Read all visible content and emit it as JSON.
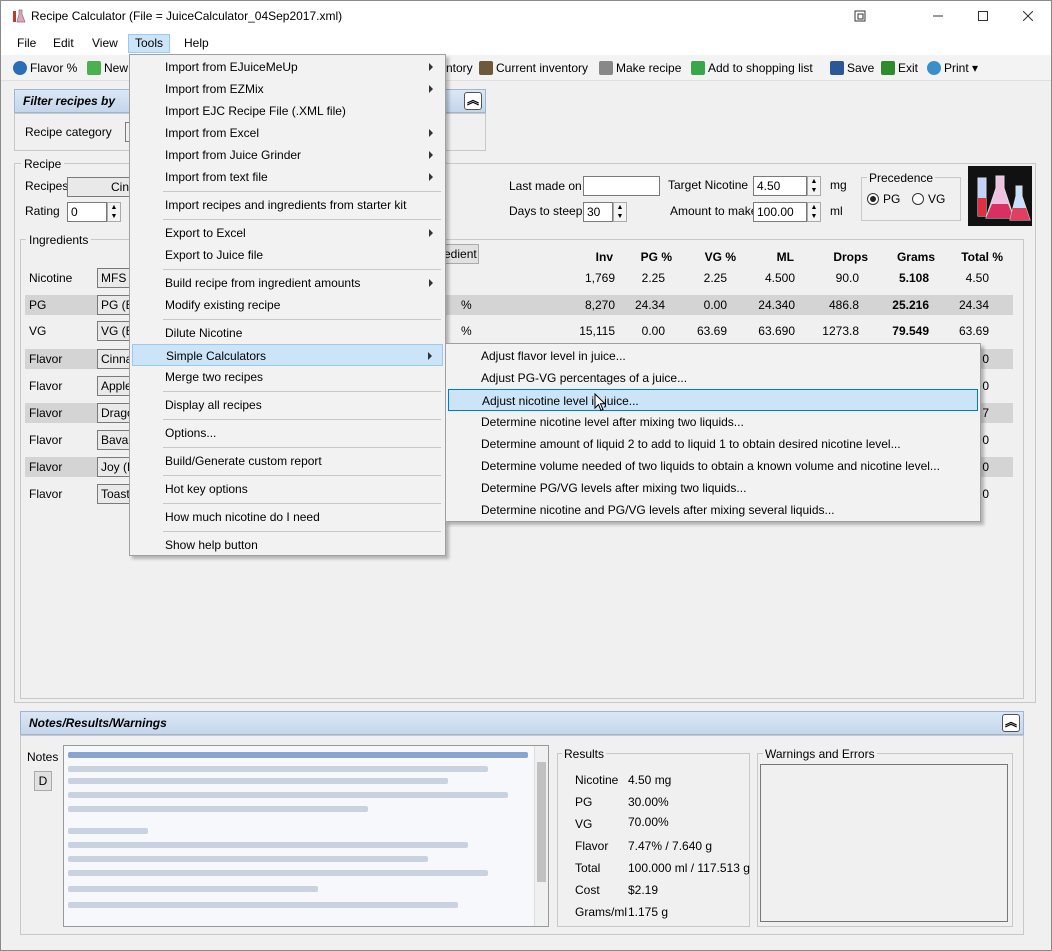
{
  "window": {
    "title": "Recipe Calculator (File = JuiceCalculator_04Sep2017.xml)"
  },
  "menubar": {
    "file": "File",
    "edit": "Edit",
    "view": "View",
    "tools": "Tools",
    "help": "Help"
  },
  "toolbar": {
    "flavor": "Flavor %",
    "new": "New",
    "inventory_partial": "ntory",
    "current_inventory": "Current inventory",
    "make_recipe": "Make recipe",
    "add_shopping": "Add to shopping list",
    "save": "Save",
    "exit": "Exit",
    "print": "Print"
  },
  "filter": {
    "title": "Filter recipes by",
    "category_label": "Recipe category"
  },
  "recipe": {
    "group_label": "Recipe",
    "recipes_label": "Recipes",
    "recipes_value": "Cin",
    "rating_label": "Rating",
    "rating_value": "0",
    "last_made_label": "Last made on",
    "last_made_value": "",
    "days_steep_label": "Days to steep",
    "days_steep_value": "30",
    "target_nic_label": "Target Nicotine",
    "target_nic_value": "4.50",
    "target_nic_unit": "mg",
    "amount_label": "Amount to make",
    "amount_value": "100.00",
    "amount_unit": "ml",
    "precedence_label": "Precedence",
    "pg_label": "PG",
    "vg_label": "VG"
  },
  "ingredients": {
    "group_label": "Ingredients",
    "add_btn_partial": "edient",
    "pct": "%",
    "headers": {
      "inv": "Inv",
      "pg": "PG %",
      "vg": "VG %",
      "ml": "ML",
      "drops": "Drops",
      "grams": "Grams",
      "total": "Total %"
    },
    "rows": [
      {
        "type": "Nicotine",
        "name": "MFS N",
        "inv": "1,769",
        "pg": "2.25",
        "vg": "2.25",
        "ml": "4.500",
        "drops": "90.0",
        "grams": "5.108",
        "total": "4.50"
      },
      {
        "type": "PG",
        "name": "PG (E",
        "inv": "8,270",
        "pg": "24.34",
        "vg": "0.00",
        "ml": "24.340",
        "drops": "486.8",
        "grams": "25.216",
        "total": "24.34"
      },
      {
        "type": "VG",
        "name": "VG (E",
        "inv": "15,115",
        "pg": "0.00",
        "vg": "63.69",
        "ml": "63.690",
        "drops": "1273.8",
        "grams": "79.549",
        "total": "63.69"
      },
      {
        "type": "Flavor",
        "name": "Cinnar",
        "total": "0"
      },
      {
        "type": "Flavor",
        "name": "Apple",
        "total": "0"
      },
      {
        "type": "Flavor",
        "name": "Drago",
        "total": "7"
      },
      {
        "type": "Flavor",
        "name": "Bavar",
        "total": "0"
      },
      {
        "type": "Flavor",
        "name": "Joy (F",
        "total": "0"
      },
      {
        "type": "Flavor",
        "name": "Toaste",
        "total": "0"
      }
    ]
  },
  "notes": {
    "title": "Notes/Results/Warnings",
    "notes_label": "Notes",
    "d_btn": "D",
    "results_label": "Results",
    "warnings_label": "Warnings and Errors",
    "results": [
      {
        "k": "Nicotine",
        "v": "4.50 mg"
      },
      {
        "k": "PG",
        "v": "30.00%"
      },
      {
        "k": "VG",
        "v": "70.00%"
      },
      {
        "k": "Flavor",
        "v": "7.47% / 7.640 g"
      },
      {
        "k": "Total",
        "v": "100.000 ml / 117.513 g"
      },
      {
        "k": "Cost",
        "v": "$2.19"
      },
      {
        "k": "Grams/ml",
        "v": "1.175 g"
      }
    ]
  },
  "tools_menu": {
    "items": [
      "Import from EJuiceMeUp",
      "Import from EZMix",
      "Import EJC Recipe File (.XML file)",
      "Import from Excel",
      "Import from Juice Grinder",
      "Import from text file",
      "Import recipes and ingredients from starter kit",
      "Export to Excel",
      "Export to Juice file",
      "Build recipe from ingredient amounts",
      "Modify existing recipe",
      "Dilute Nicotine",
      "Simple Calculators",
      "Merge two recipes",
      "Display all recipes",
      "Options...",
      "Build/Generate custom report",
      "Hot key options",
      "How much nicotine do I need",
      "Show help button"
    ]
  },
  "calc_submenu": {
    "items": [
      "Adjust flavor level in juice...",
      "Adjust PG-VG percentages of a juice...",
      "Adjust nicotine level in juice...",
      "Determine nicotine level after mixing two liquids...",
      "Determine amount of liquid 2 to add to liquid 1 to obtain desired nicotine level...",
      "Determine volume needed of two liquids to obtain a known volume and nicotine level...",
      "Determine PG/VG levels after mixing two liquids...",
      "Determine nicotine and PG/VG levels after mixing several liquids..."
    ]
  }
}
